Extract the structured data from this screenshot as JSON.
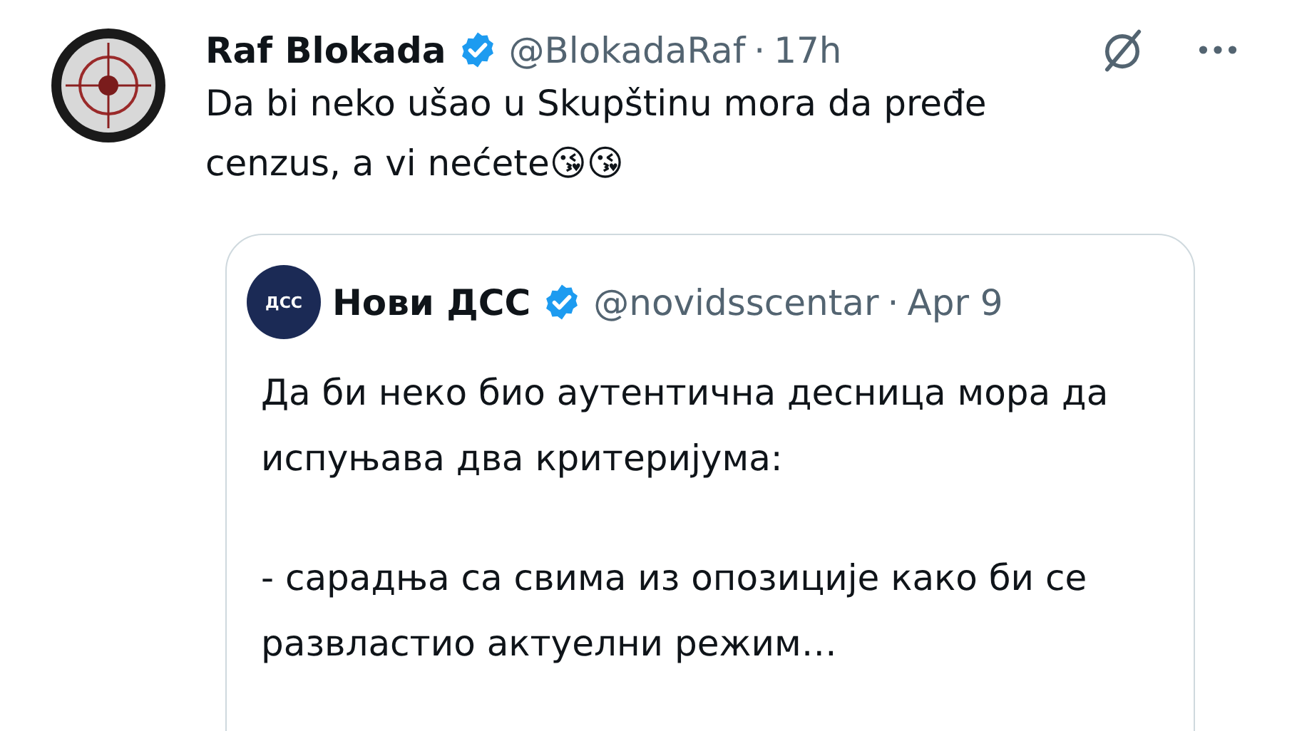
{
  "tweet": {
    "author_name": "Raf Blokada",
    "verified": true,
    "handle": "@BlokadaRaf",
    "separator": "·",
    "time": "17h",
    "text": "Da bi neko ušao u Skupštinu mora da pređe cenzus, a vi nećete😘😘",
    "quote": {
      "avatar_text": "ДСС",
      "author_name": "Нови ДСС",
      "verified": true,
      "handle": "@novidsscentar",
      "separator": "·",
      "time": "Apr 9",
      "paragraphs": [
        "Да би неко био аутентична десница мора да испуњава два критеријума:",
        "- сарадња са свима из опозиције како би се развластио актуелни режим…"
      ]
    }
  }
}
